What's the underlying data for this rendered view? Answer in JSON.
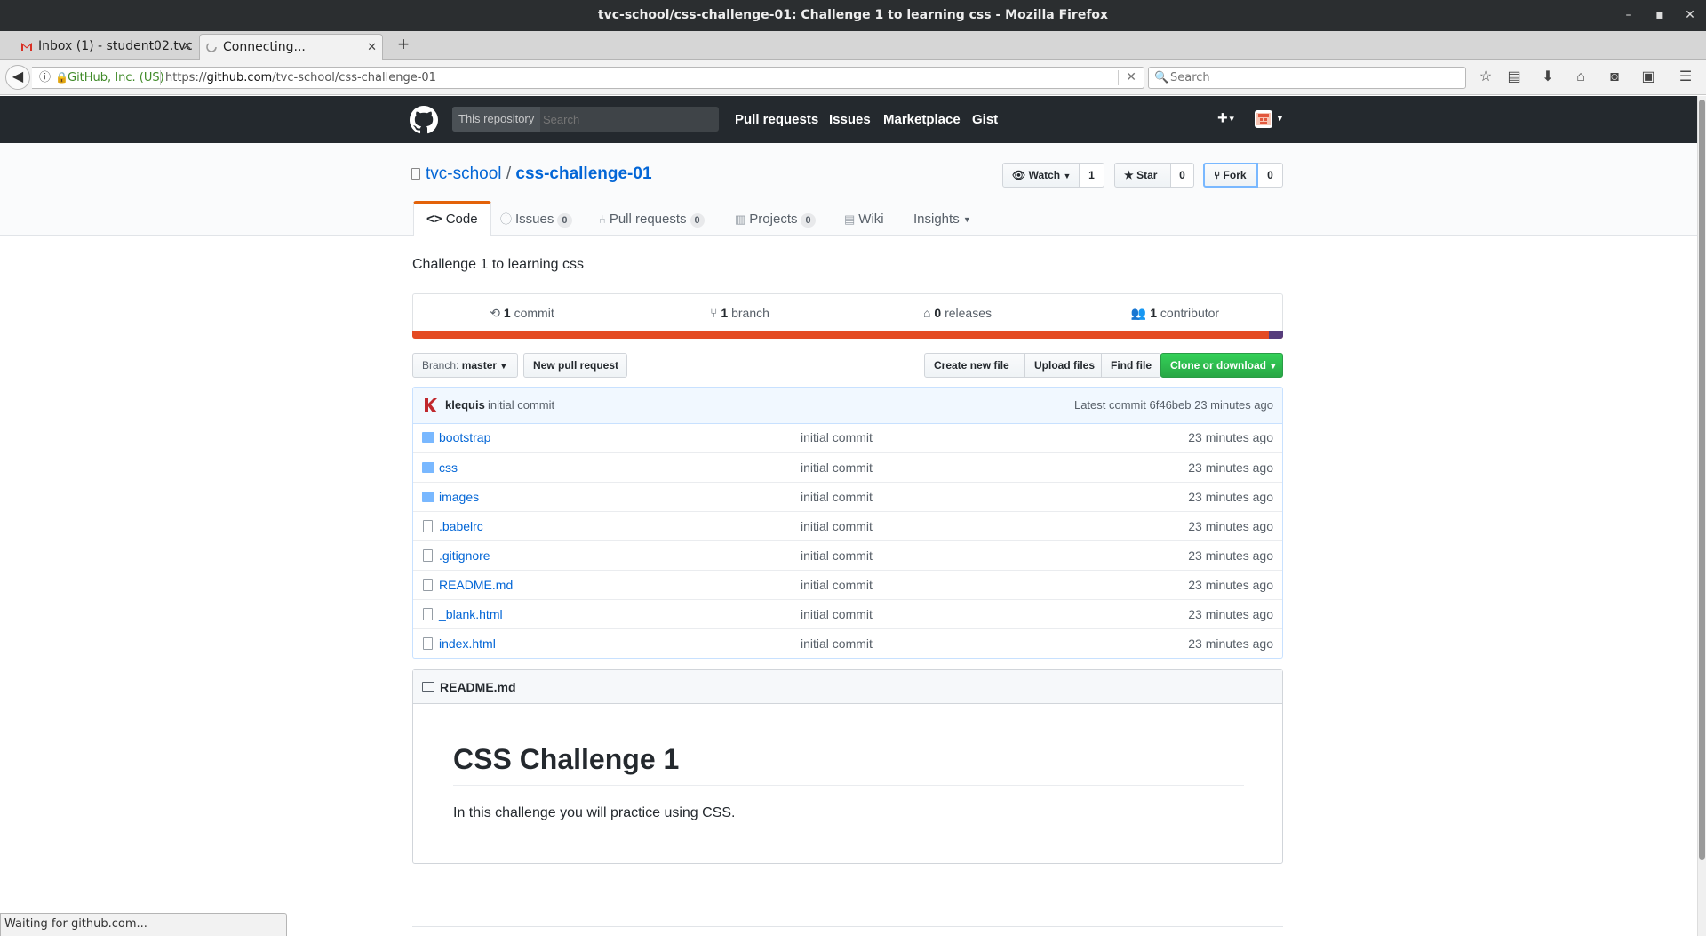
{
  "window": {
    "title": "tvc-school/css-challenge-01: Challenge 1 to learning css - Mozilla Firefox",
    "minimize_icon": "minimize-icon",
    "maximize_icon": "maximize-icon",
    "close_icon": "close-icon"
  },
  "tabs": [
    {
      "label": "Inbox (1) - student02.tvc",
      "icon": "gmail-icon",
      "active": false
    },
    {
      "label": "Connecting...",
      "icon": "loading-spinner-icon",
      "active": true
    }
  ],
  "navbar": {
    "identity": "GitHub, Inc. (US)",
    "url_prefix": "https://",
    "url_domain": "github.com",
    "url_path": "/tvc-school/css-challenge-01",
    "search_placeholder": "Search"
  },
  "gh_header": {
    "scope_label": "This repository",
    "search_placeholder": "Search",
    "nav": [
      "Pull requests",
      "Issues",
      "Marketplace",
      "Gist"
    ],
    "plus": "+"
  },
  "repo": {
    "owner": "tvc-school",
    "separator": "/",
    "name": "css-challenge-01",
    "watch_label": "Watch",
    "watch_count": "1",
    "star_label": "Star",
    "star_count": "0",
    "fork_label": "Fork",
    "fork_count": "0",
    "tabs": [
      {
        "label": "Code",
        "count": null,
        "icon": "code-icon"
      },
      {
        "label": "Issues",
        "count": "0",
        "icon": "issue-icon"
      },
      {
        "label": "Pull requests",
        "count": "0",
        "icon": "pull-request-icon"
      },
      {
        "label": "Projects",
        "count": "0",
        "icon": "project-icon"
      },
      {
        "label": "Wiki",
        "count": null,
        "icon": "book-icon"
      },
      {
        "label": "Insights",
        "count": null,
        "icon": "caret-down-icon"
      }
    ],
    "description": "Challenge 1 to learning css",
    "numbers": [
      {
        "count": "1",
        "label": "commit",
        "icon": "history-icon"
      },
      {
        "count": "1",
        "label": "branch",
        "icon": "branch-icon"
      },
      {
        "count": "0",
        "label": "releases",
        "icon": "tag-icon"
      },
      {
        "count": "1",
        "label": "contributor",
        "icon": "people-icon"
      }
    ],
    "language_colors": {
      "primary": "#e44b23",
      "secondary": "#563d7c"
    },
    "branch_prefix": "Branch:",
    "branch": "master",
    "new_pr": "New pull request",
    "create_file": "Create new file",
    "upload_files": "Upload files",
    "find_file": "Find file",
    "clone": "Clone or download",
    "commit_author": "klequis",
    "commit_message": "initial commit",
    "commit_meta": "Latest commit 6f46beb 23 minutes ago",
    "files": [
      {
        "name": "bootstrap",
        "type": "folder",
        "message": "initial commit",
        "age": "23 minutes ago"
      },
      {
        "name": "css",
        "type": "folder",
        "message": "initial commit",
        "age": "23 minutes ago"
      },
      {
        "name": "images",
        "type": "folder",
        "message": "initial commit",
        "age": "23 minutes ago"
      },
      {
        "name": ".babelrc",
        "type": "file",
        "message": "initial commit",
        "age": "23 minutes ago"
      },
      {
        "name": ".gitignore",
        "type": "file",
        "message": "initial commit",
        "age": "23 minutes ago"
      },
      {
        "name": "README.md",
        "type": "file",
        "message": "initial commit",
        "age": "23 minutes ago"
      },
      {
        "name": "_blank.html",
        "type": "file",
        "message": "initial commit",
        "age": "23 minutes ago"
      },
      {
        "name": "index.html",
        "type": "file",
        "message": "initial commit",
        "age": "23 minutes ago"
      }
    ],
    "readme_title": "README.md",
    "readme_h1": "CSS Challenge 1",
    "readme_p": "In this challenge you will practice using CSS."
  },
  "status": "Waiting for github.com..."
}
